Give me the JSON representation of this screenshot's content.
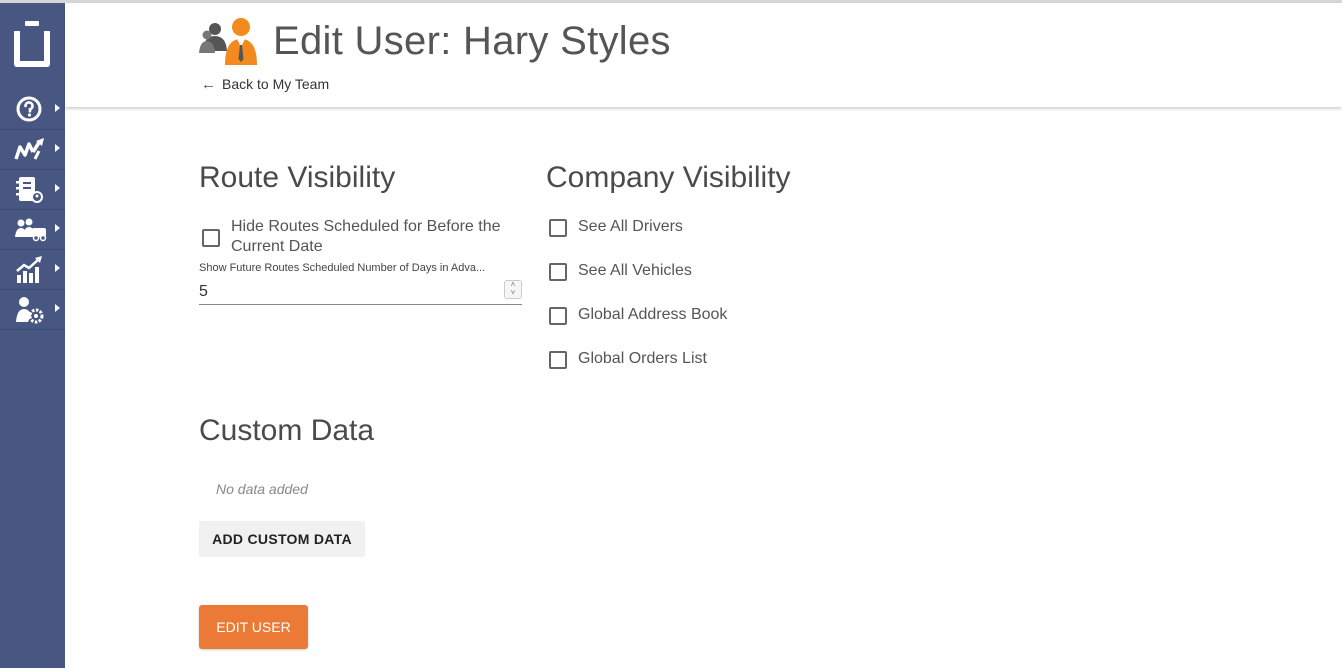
{
  "header": {
    "title": "Edit User: Hary Styles",
    "back_link": "Back to My Team"
  },
  "sidebar": {
    "items": [
      {
        "icon": "help-icon"
      },
      {
        "icon": "routes-icon"
      },
      {
        "icon": "address-book-icon"
      },
      {
        "icon": "fleet-icon"
      },
      {
        "icon": "analytics-icon"
      },
      {
        "icon": "user-settings-icon"
      }
    ]
  },
  "route_visibility": {
    "heading": "Route Visibility",
    "hide_routes_label_line1": "Hide Routes Scheduled for Before the",
    "hide_routes_label_line2": "Current Date",
    "hide_routes_checked": false,
    "future_days_label": "Show Future Routes Scheduled Number of Days in Adva...",
    "future_days_value": "5"
  },
  "company_visibility": {
    "heading": "Company Visibility",
    "options": [
      {
        "label": "See All Drivers",
        "checked": false
      },
      {
        "label": "See All Vehicles",
        "checked": false
      },
      {
        "label": "Global Address Book",
        "checked": false
      },
      {
        "label": "Global Orders List",
        "checked": false
      }
    ]
  },
  "custom_data": {
    "heading": "Custom Data",
    "empty_text": "No data added",
    "add_button": "ADD CUSTOM DATA"
  },
  "submit_button": "EDIT USER",
  "colors": {
    "sidebar": "#485782",
    "accent": "#ea7a35",
    "text": "#555555"
  }
}
